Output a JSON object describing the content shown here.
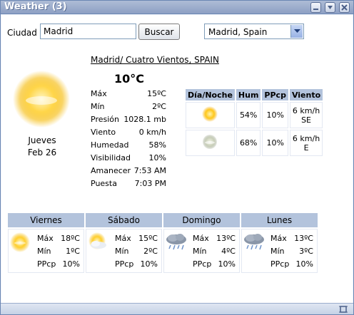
{
  "window": {
    "title": "Weather (3)"
  },
  "search": {
    "city_label": "Ciudad",
    "city_value": "Madrid",
    "search_button": "Buscar",
    "location_selected": "Madrid, Spain"
  },
  "current": {
    "station": "Madrid/ Cuatro Vientos, SPAIN",
    "temperature": "10°C",
    "day": "Jueves",
    "date": "Feb 26",
    "icon": "sunny-icon",
    "rows": [
      {
        "key": "Máx",
        "value": "15ºC"
      },
      {
        "key": "Mín",
        "value": "2ºC"
      },
      {
        "key": "Presión",
        "value": "1028.1 mb"
      },
      {
        "key": "Viento",
        "value": "0 km/h"
      },
      {
        "key": "Humedad",
        "value": "58%"
      },
      {
        "key": "Visibilidad",
        "value": "10%"
      },
      {
        "key": "Amanecer",
        "value": "7:53 AM"
      },
      {
        "key": "Puesta",
        "value": "7:03 PM"
      }
    ]
  },
  "daynight": {
    "headers": [
      "Día/Noche",
      "Hum",
      "PPcp",
      "Viento"
    ],
    "rows": [
      {
        "icon": "sun-icon",
        "hum": "54%",
        "ppcp": "10%",
        "wind": "6 km/h",
        "dir": "SE"
      },
      {
        "icon": "moon-icon",
        "hum": "68%",
        "ppcp": "10%",
        "wind": "6 km/h",
        "dir": "E"
      }
    ]
  },
  "forecast": [
    {
      "day": "Viernes",
      "icon": "sunny-icon",
      "max": "18ºC",
      "min": "1ºC",
      "ppcp": "10%"
    },
    {
      "day": "Sábado",
      "icon": "partly-cloudy-icon",
      "max": "15ºC",
      "min": "2ºC",
      "ppcp": "10%"
    },
    {
      "day": "Domingo",
      "icon": "rain-cloud-icon",
      "max": "13ºC",
      "min": "4ºC",
      "ppcp": "10%"
    },
    {
      "day": "Lunes",
      "icon": "rain-cloud-icon",
      "max": "13ºC",
      "min": "3ºC",
      "ppcp": "10%"
    }
  ],
  "labels": {
    "max": "Máx",
    "min": "Mín",
    "ppcp": "PPcp"
  },
  "colors": {
    "title_bar": "#8da0c4",
    "header_cell": "#b3c3dc",
    "sun": "#f5b800"
  }
}
